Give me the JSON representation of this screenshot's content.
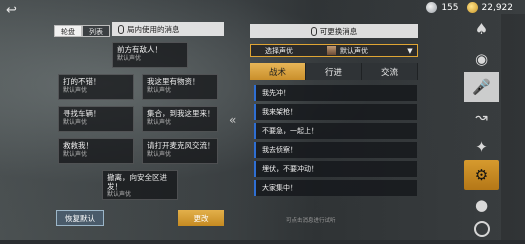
{
  "currency": {
    "silver": "155",
    "gold": "22,922"
  },
  "left_panel": {
    "tabs": [
      "轮盘",
      "列表"
    ],
    "title": "局内使用的消息",
    "messages": [
      {
        "text": "前方有敌人！",
        "voice": "默认声优"
      },
      {
        "text": "打的不错！",
        "voice": "默认声优"
      },
      {
        "text": "我这里有物资！",
        "voice": "默认声优"
      },
      {
        "text": "寻找车辆！",
        "voice": "默认声优"
      },
      {
        "text": "集合，到我这里来！",
        "voice": "默认声优"
      },
      {
        "text": "救救我！",
        "voice": "默认声优"
      },
      {
        "text": "请打开麦克风交流！",
        "voice": "默认声优"
      },
      {
        "text": "撤离，向安全区进发！",
        "voice": "默认声优"
      }
    ],
    "restore_label": "恢复默认",
    "change_label": "更改"
  },
  "right_panel": {
    "title": "可更换消息",
    "voice_select_label": "选择声优",
    "voice_select_value": "默认声优",
    "tabs": [
      "战术",
      "行进",
      "交流"
    ],
    "active_tab": "战术",
    "items": [
      "我先冲！",
      "我来架枪！",
      "不要急，一起上！",
      "我去侦察！",
      "埋伏，不要冲动！",
      "大家集中！"
    ],
    "hint": "可点击消息进行试听"
  },
  "sidebar": [
    "character-icon",
    "backpack-icon",
    "parachute-icon",
    "microphone-icon",
    "rifle-icon",
    "wings-icon",
    "melee-icon",
    "helmet-icon",
    "vest-icon",
    "settings-icon"
  ],
  "colors": {
    "accent": "#d69a2e",
    "blue": "#2f6fd3"
  }
}
